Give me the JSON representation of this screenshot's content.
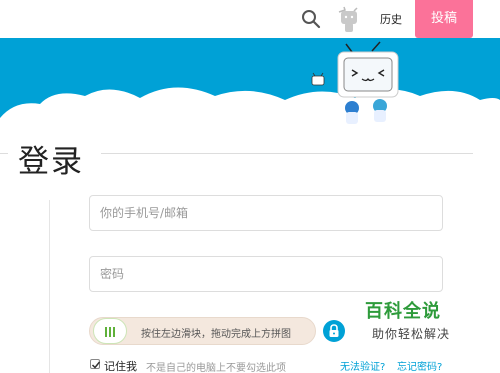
{
  "header": {
    "history_label": "历史",
    "upload_label": "投稿"
  },
  "icons": {
    "search": "search-icon",
    "avatar": "avatar",
    "lock": "lock-icon",
    "mascot": "bilibili-tv-mascot"
  },
  "colors": {
    "brand_blue": "#00a1d6",
    "brand_pink": "#fb7299"
  },
  "login": {
    "title": "登录",
    "account_placeholder": "你的手机号/邮箱",
    "password_placeholder": "密码",
    "slider_text": "按住左边滑块，拖动完成上方拼图",
    "remember_label": "记住我",
    "remember_checked": true,
    "remember_hint": "不是自己的电脑上不要勾选此项",
    "cant_verify_link": "无法验证?",
    "forgot_password_link": "忘记密码?"
  },
  "watermark": {
    "title": "百科全说",
    "subtitle": "助你轻松解决"
  }
}
